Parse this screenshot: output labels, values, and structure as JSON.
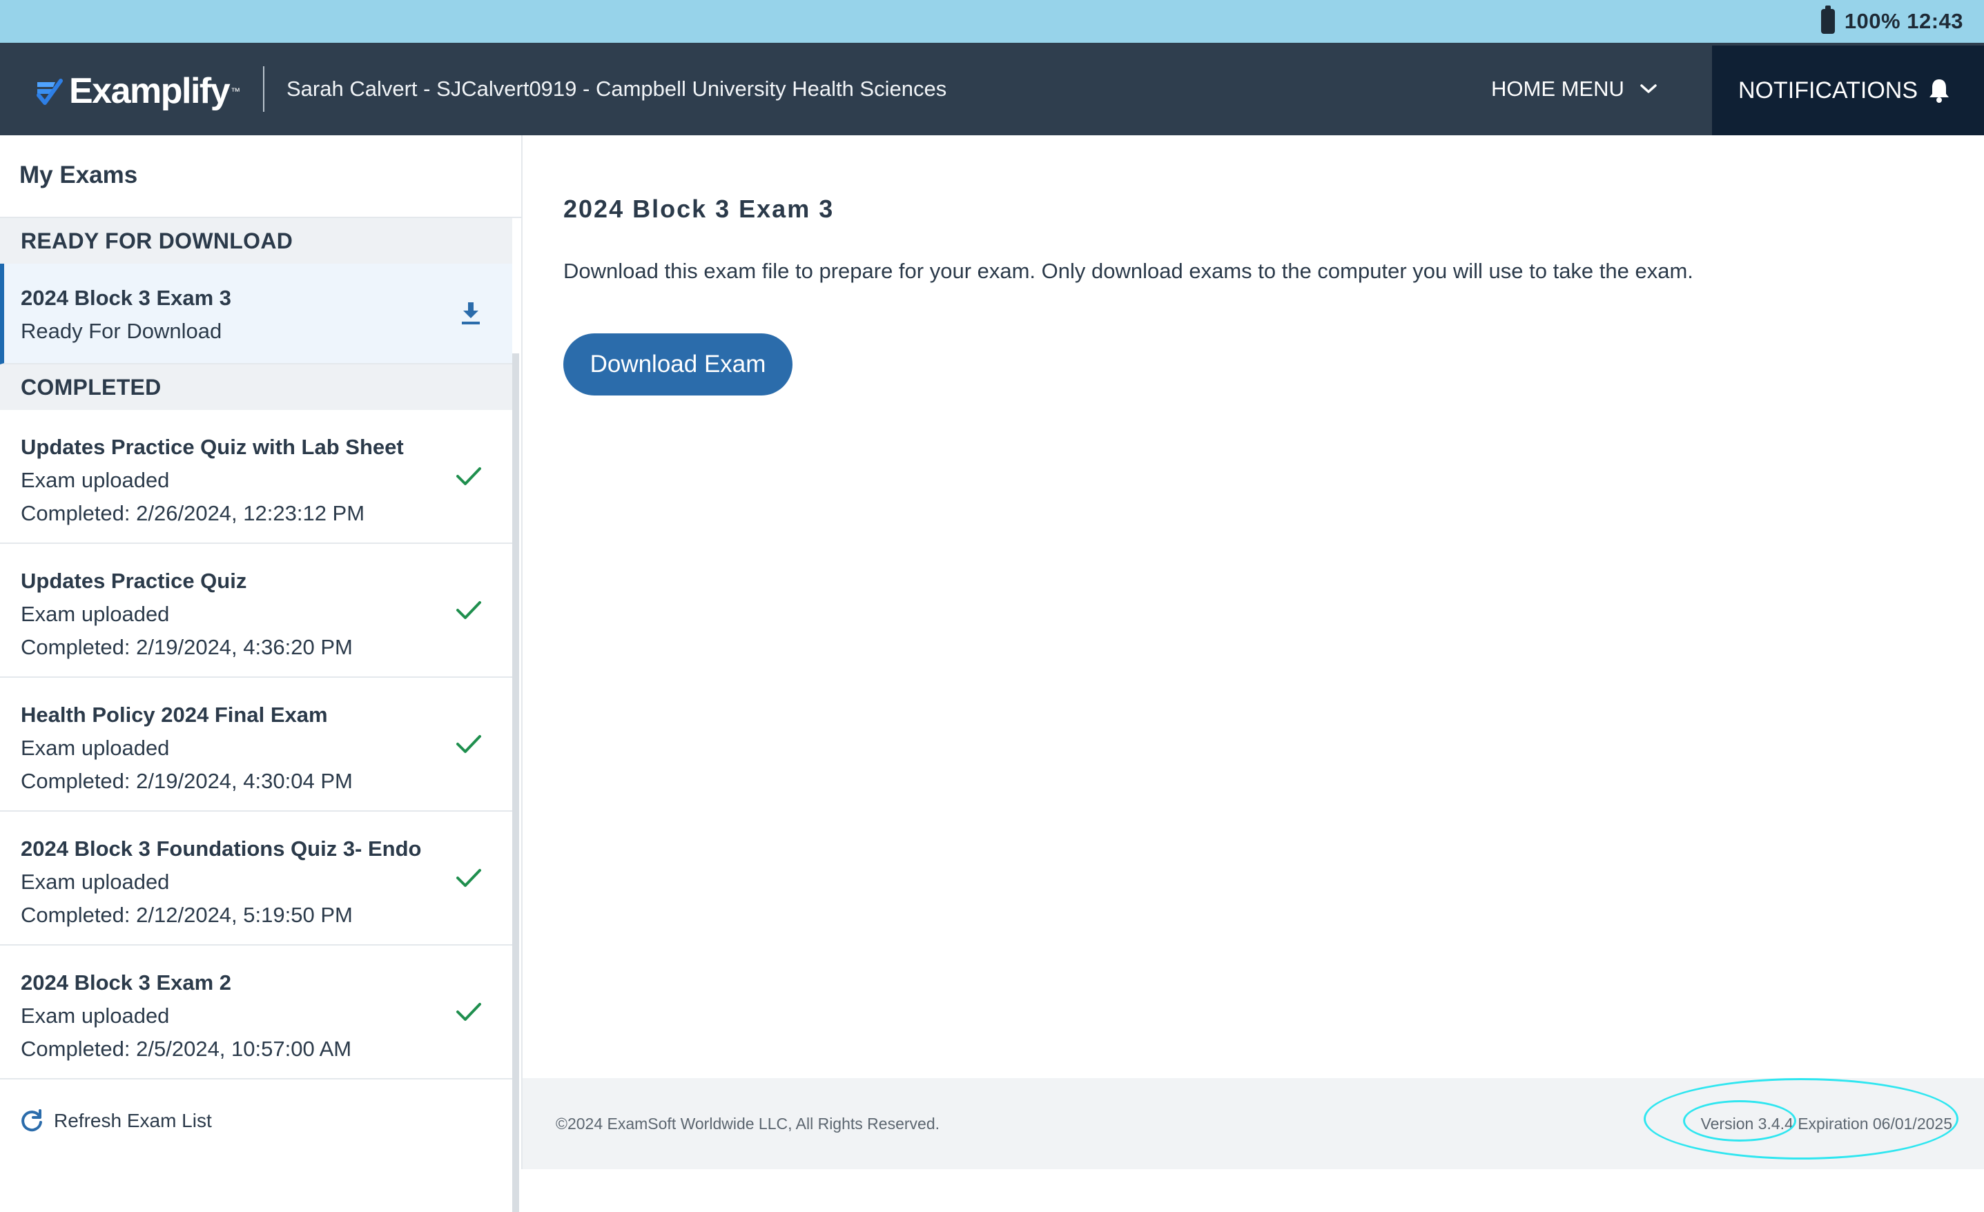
{
  "status_bar": {
    "battery_text": "100% 12:43"
  },
  "header": {
    "logo_text": "Examplify",
    "logo_tm": "™",
    "user_info": "Sarah Calvert - SJCalvert0919 - Campbell University Health Sciences",
    "home_menu_label": "HOME MENU",
    "notifications_label": "NOTIFICATIONS"
  },
  "sidebar": {
    "title": "My Exams",
    "sections": [
      {
        "header": "READY FOR DOWNLOAD",
        "items": [
          {
            "title": "2024 Block 3 Exam 3",
            "status": "Ready For Download",
            "icon": "download-icon"
          }
        ]
      },
      {
        "header": "COMPLETED",
        "items": [
          {
            "title": "Updates Practice Quiz with Lab Sheet",
            "status": "Exam uploaded",
            "completed": "Completed: 2/26/2024, 12:23:12 PM",
            "icon": "checkmark-icon"
          },
          {
            "title": "Updates Practice Quiz",
            "status": "Exam uploaded",
            "completed": "Completed: 2/19/2024, 4:36:20 PM",
            "icon": "checkmark-icon"
          },
          {
            "title": "Health Policy 2024 Final Exam",
            "status": "Exam uploaded",
            "completed": "Completed: 2/19/2024, 4:30:04 PM",
            "icon": "checkmark-icon"
          },
          {
            "title": "2024 Block 3 Foundations Quiz 3- Endo",
            "status": "Exam uploaded",
            "completed": "Completed: 2/12/2024, 5:19:50 PM",
            "icon": "checkmark-icon"
          },
          {
            "title": "2024 Block 3 Exam 2",
            "status": "Exam uploaded",
            "completed": "Completed: 2/5/2024, 10:57:00 AM",
            "icon": "checkmark-icon"
          }
        ]
      }
    ],
    "refresh_label": "Refresh Exam List"
  },
  "main": {
    "title": "2024 Block 3 Exam 3",
    "description": "Download this exam file to prepare for your exam. Only download exams to the computer you will use to take the exam.",
    "download_button": "Download Exam"
  },
  "footer": {
    "copyright": "©2024 ExamSoft Worldwide LLC, All Rights Reserved.",
    "version": "Version 3.4.4 Expiration 06/01/2025"
  },
  "colors": {
    "status_bar": "#97d3ea",
    "header_bg": "#2f3e4e",
    "notifications_bg": "#0f2034",
    "accent": "#2b6cab",
    "check_green": "#1f8f4e",
    "annotation": "#2fe6f0"
  }
}
